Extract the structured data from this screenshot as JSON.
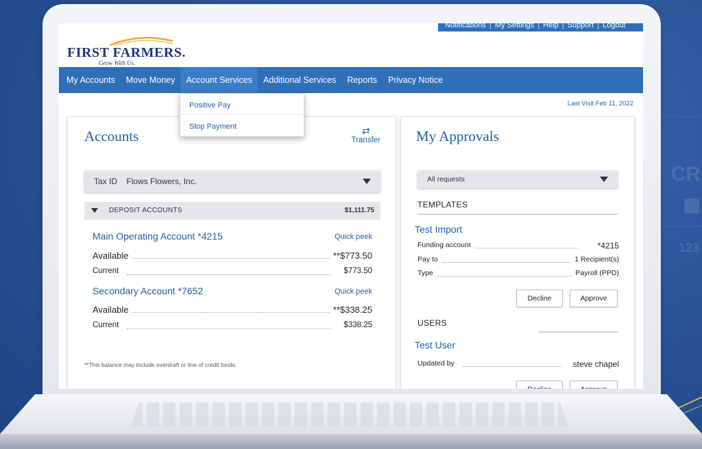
{
  "header": {
    "top_links": [
      "Notifications",
      "My Settings",
      "Help",
      "Support",
      "Logout"
    ],
    "logo_name": "FIRST FARMERS.",
    "logo_tagline": "Grow With Us."
  },
  "nav": {
    "items": [
      "My Accounts",
      "Move Money",
      "Account Services",
      "Additional Services",
      "Reports",
      "Privacy Notice"
    ],
    "active": "Account Services"
  },
  "dropdown": {
    "items": [
      "Positive Pay",
      "Stop Payment"
    ]
  },
  "last_visit": "Last Visit Feb 11, 2022",
  "accounts": {
    "title": "Accounts",
    "transfer_label": "Transfer",
    "tax_id_label": "Tax ID",
    "tax_id_value": "Flows Flowers, Inc.",
    "section_label": "DEPOSIT ACCOUNTS",
    "section_total": "$1,111.75",
    "list": [
      {
        "name": "Main Operating Account  *4215",
        "quick_peek": "Quick peek",
        "available_label": "Available",
        "available_value": "**$773.50",
        "current_label": "Current",
        "current_value": "$773.50"
      },
      {
        "name": "Secondary Account  *7652",
        "quick_peek": "Quick peek",
        "available_label": "Available",
        "available_value": "**$338.25",
        "current_label": "Current",
        "current_value": "$338.25"
      }
    ],
    "footnote": "**This balance may include overdraft or line of credit funds."
  },
  "approvals": {
    "title": "My Approvals",
    "filter_value": "All requests",
    "templates_label": "TEMPLATES",
    "template": {
      "name": "Test Import",
      "funding_label": "Funding account",
      "funding_value": "*4215",
      "payto_label": "Pay to",
      "payto_value": "1 Recipient(s)",
      "type_label": "Type",
      "type_value": "Payroll (PPD)",
      "decline_label": "Decline",
      "approve_label": "Approve"
    },
    "users_label": "USERS",
    "user": {
      "name": "Test User",
      "updated_label": "Updated by",
      "updated_value": "steve chapel",
      "decline_label": "Decline",
      "approve_label": "Approve"
    }
  },
  "background": {
    "text_cr": "CR",
    "text_123": "123"
  },
  "colors": {
    "brand_blue": "#2f6fb8",
    "link_blue": "#1f5fa8",
    "logo_navy": "#1e3a78",
    "logo_gold": "#e8a93a",
    "bg_blue": "#2a5598"
  }
}
